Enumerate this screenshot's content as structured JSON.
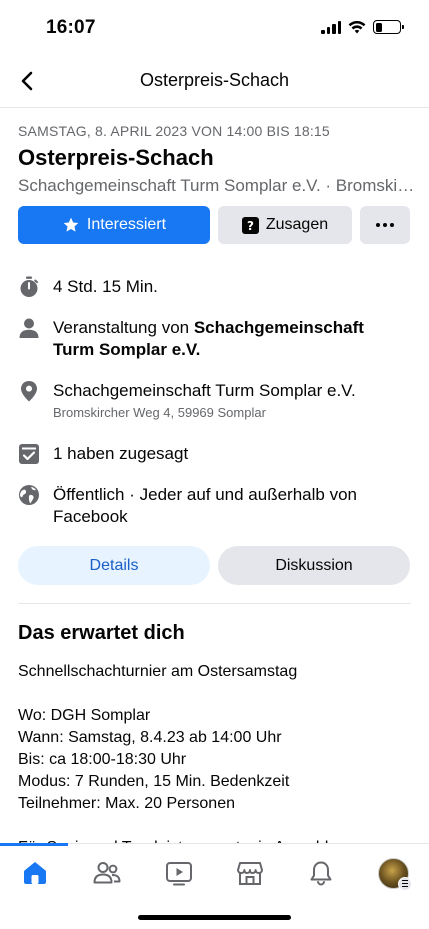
{
  "status_bar": {
    "time": "16:07"
  },
  "header": {
    "title": "Osterpreis-Schach"
  },
  "event": {
    "date_line": "SAMSTAG, 8. APRIL 2023 VON 14:00 BIS 18:15",
    "title": "Osterpreis-Schach",
    "host_line": "Schachgemeinschaft Turm Somplar e.V. · Bromskircher Weg 4, 59969 Somplar"
  },
  "actions": {
    "interested_label": "Interessiert",
    "going_label": "Zusagen"
  },
  "info": {
    "duration": "4 Std. 15 Min.",
    "organizer_prefix": "Veranstaltung von ",
    "organizer_name": "Schachgemeinschaft Turm Somplar e.V.",
    "location_name": "Schachgemeinschaft Turm Somplar e.V.",
    "location_address": "Bromskircher Weg 4, 59969 Somplar",
    "attendance": "1 haben zugesagt",
    "privacy": "Öffentlich · Jeder auf und außerhalb von Facebook"
  },
  "tabs": {
    "details": "Details",
    "discussion": "Diskussion"
  },
  "about": {
    "heading": "Das erwartet dich",
    "intro": "Schnellschachturnier am Ostersamstag",
    "where": "Wo: DGH Somplar",
    "when": "Wann: Samstag, 8.4.23 ab 14:00 Uhr",
    "until": "Bis: ca 18:00-18:30 Uhr",
    "mode": "Modus: 7 Runden, 15 Min. Bedenkzeit",
    "participants": "Teilnehmer: Max. 20 Personen",
    "cutoff": "Für Speis und Trank ist gesorgt, ein Anmeldung..."
  },
  "colors": {
    "accent": "#1877f2",
    "secondary_text": "#65676b",
    "button_grey": "#e4e6eb",
    "tab_active_bg": "#e7f3ff"
  },
  "icons": {
    "duration": "stopwatch-icon",
    "organizer": "person-icon",
    "location": "map-pin-icon",
    "attendance": "check-calendar-icon",
    "privacy": "globe-icon",
    "nav": [
      "home-icon",
      "friends-icon",
      "video-icon",
      "marketplace-icon",
      "bell-icon",
      "avatar"
    ]
  }
}
